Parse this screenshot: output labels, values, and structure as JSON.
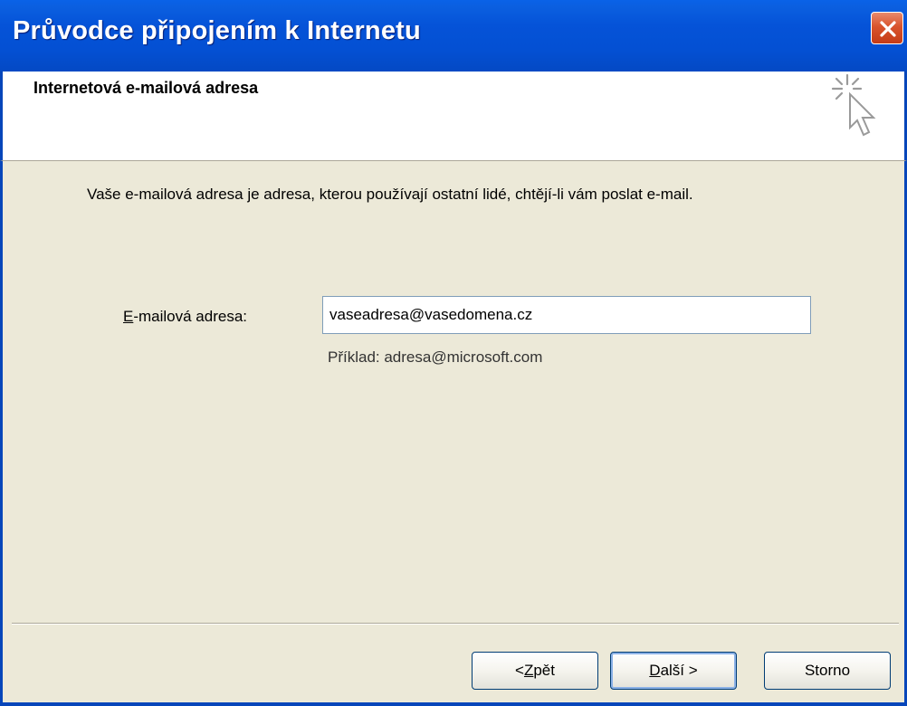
{
  "window": {
    "title": "Průvodce připojením k Internetu",
    "close_icon": "close-icon"
  },
  "header": {
    "title": "Internetová e-mailová adresa",
    "icon": "wizard-cursor-sparkle-icon"
  },
  "content": {
    "description": "Vaše e-mailová adresa je adresa, kterou používají ostatní lidé, chtějí-li vám poslat e-mail.",
    "email_label_first": "E",
    "email_label_rest": "-mailová adresa:",
    "email_value": "vaseadresa@vasedomena.cz",
    "example": "Příklad: adresa@microsoft.com"
  },
  "buttons": {
    "back_prefix": "< ",
    "back_accel": "Z",
    "back_rest": "pět",
    "next_accel": "D",
    "next_rest": "alší >",
    "cancel": "Storno"
  },
  "colors": {
    "titlebar": "#0553d8",
    "dialog_bg": "#ece9d8",
    "header_bg": "#ffffff",
    "close_button": "#d9542d"
  }
}
